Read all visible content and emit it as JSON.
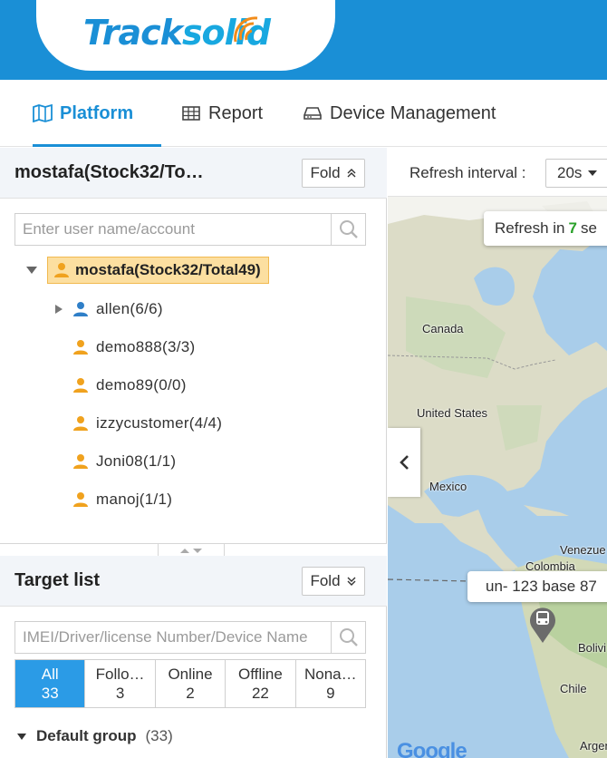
{
  "app": {
    "logo_track": "Track",
    "logo_solid": "solid"
  },
  "nav": {
    "tabs": [
      {
        "label": "Platform",
        "icon": "map-icon",
        "active": true
      },
      {
        "label": "Report",
        "icon": "table-icon",
        "active": false
      },
      {
        "label": "Device Management",
        "icon": "device-icon",
        "active": false
      }
    ]
  },
  "user_panel": {
    "title": "mostafa(Stock32/To…",
    "fold_label": "Fold",
    "search_placeholder": "Enter user name/account",
    "root": "mostafa(Stock32/Total49)",
    "children": [
      {
        "label": "allen(6/6)",
        "expandable": true
      },
      {
        "label": "demo888(3/3)",
        "expandable": false
      },
      {
        "label": "demo89(0/0)",
        "expandable": false
      },
      {
        "label": "izzycustomer(4/4)",
        "expandable": false
      },
      {
        "label": "Joni08(1/1)",
        "expandable": false
      },
      {
        "label": "manoj(1/1)",
        "expandable": false
      }
    ]
  },
  "target_panel": {
    "title": "Target list",
    "fold_label": "Fold",
    "search_placeholder": "IMEI/Driver/license Number/Device Name",
    "filters": [
      {
        "label": "All",
        "count": "33",
        "active": true
      },
      {
        "label": "Follo…",
        "count": "3",
        "active": false
      },
      {
        "label": "Online",
        "count": "2",
        "active": false
      },
      {
        "label": "Offline",
        "count": "22",
        "active": false
      },
      {
        "label": "Nona…",
        "count": "9",
        "active": false
      }
    ],
    "group": {
      "name": "Default group",
      "count": "(33)"
    }
  },
  "map_panel": {
    "refresh_label": "Refresh interval",
    "refresh_colon": ":",
    "interval": "20s",
    "refresh_tip_prefix": "Refresh in",
    "refresh_tip_num": "7",
    "refresh_tip_suffix": "se",
    "labels": {
      "canada": "Canada",
      "us": "United States",
      "mexico": "Mexico",
      "venezuela": "Venezue",
      "colombia": "Colombia",
      "bolivia": "Bolivi",
      "chile": "Chile",
      "argentina": "Argen"
    },
    "device_tip": "un- 123 base 87",
    "attribution": "Google"
  },
  "colors": {
    "brand_blue": "#1a8fd6",
    "active_filter": "#2b9be6",
    "root_highlight": "#fcdfa0",
    "user_orange": "#f0a21e",
    "user_blue": "#2f7fc8",
    "refresh_green": "#2aa12a"
  }
}
